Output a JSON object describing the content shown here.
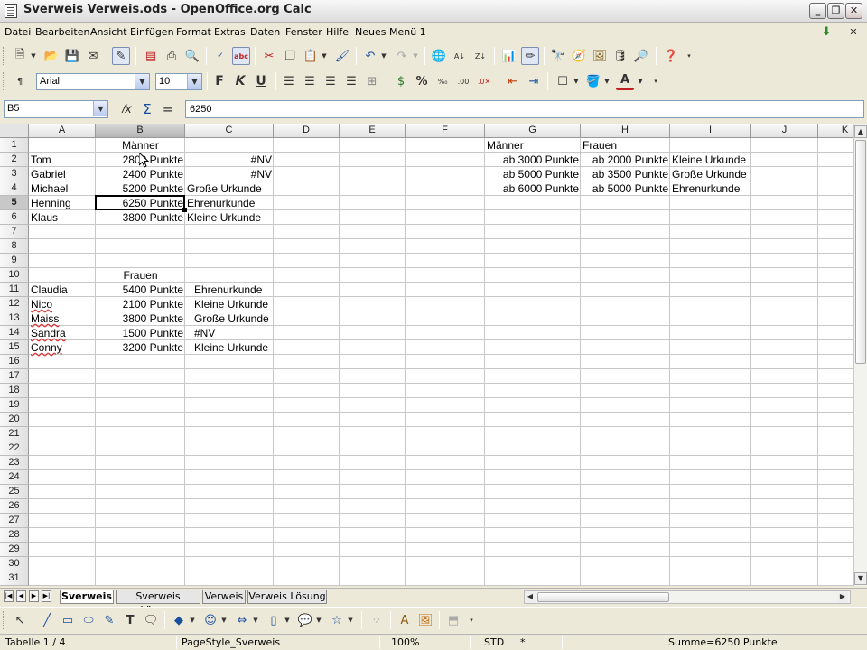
{
  "window": {
    "title": "Sverweis Verweis.ods - OpenOffice.org Calc"
  },
  "menu": [
    "Datei",
    "Bearbeiten",
    "Ansicht",
    "Einfügen",
    "Format",
    "Extras",
    "Daten",
    "Fenster",
    "Hilfe",
    "Neues Menü 1"
  ],
  "toolbar": {
    "font_name": "Arial",
    "font_size": "10"
  },
  "formula_bar": {
    "cell_ref": "B5",
    "content": "6250"
  },
  "columns": [
    "A",
    "B",
    "C",
    "D",
    "E",
    "F",
    "G",
    "H",
    "I",
    "J",
    "K"
  ],
  "rows": [
    "1",
    "2",
    "3",
    "4",
    "5",
    "6",
    "7",
    "8",
    "9",
    "10",
    "11",
    "12",
    "13",
    "14",
    "15",
    "16",
    "17",
    "18",
    "19",
    "20",
    "21",
    "22",
    "23",
    "24",
    "25",
    "26",
    "27",
    "28",
    "29",
    "30",
    "31"
  ],
  "cells": {
    "B1": "Männer",
    "A2": "Tom",
    "B2": "2800 Punkte",
    "C2": "#NV",
    "A3": "Gabriel",
    "B3": "2400 Punkte",
    "C3": "#NV",
    "A4": "Michael",
    "B4": "5200 Punkte",
    "C4": "Große Urkunde",
    "A5": "Henning",
    "B5": "6250 Punkte",
    "C5": "Ehrenurkunde",
    "A6": "Klaus",
    "B6": "3800 Punkte",
    "C6": "Kleine Urkunde",
    "B10": "Frauen",
    "A11": "Claudia",
    "B11": "5400 Punkte",
    "C11": "Ehrenurkunde",
    "A12": "Nico",
    "B12": "2100 Punkte",
    "C12": "Kleine Urkunde",
    "A13": "Maiss",
    "B13": "3800 Punkte",
    "C13": "Große Urkunde",
    "A14": "Sandra",
    "B14": "1500 Punkte",
    "C14": "#NV",
    "A15": "Conny",
    "B15": "3200 Punkte",
    "C15": "Kleine Urkunde",
    "G1": "Männer",
    "H1": "Frauen",
    "G2": "ab 3000 Punkte",
    "H2": "ab 2000 Punkte",
    "I2": "Kleine Urkunde",
    "G3": "ab 5000 Punkte",
    "H3": "ab 3500 Punkte",
    "I3": "Große Urkunde",
    "G4": "ab 6000 Punkte",
    "H4": "ab 5000 Punkte",
    "I4": "Ehrenurkunde"
  },
  "sheet_tabs": [
    "Sverweis",
    "Sverweis Lösung",
    "Verweis",
    "Verweis Lösung"
  ],
  "status": {
    "sheet": "Tabelle 1 / 4",
    "page_style": "PageStyle_Sverweis",
    "zoom": "100%",
    "mode": "STD",
    "modified": "*",
    "sum": "Summe=6250 Punkte"
  },
  "colors": {
    "selection_border": "#000000",
    "header_selected": "#c8c8c8",
    "spell_underline": "#e03030"
  }
}
